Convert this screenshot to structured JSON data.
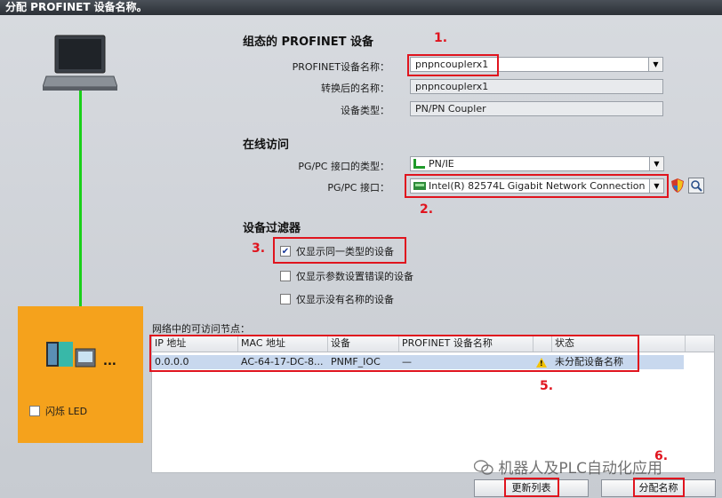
{
  "window": {
    "title": "分配 PROFINET 设备名称。"
  },
  "config": {
    "section_title": "组态的 PROFINET 设备",
    "device_name_label": "PROFINET设备名称：",
    "device_name_value": "pnpncouplerx1",
    "converted_name_label": "转换后的名称：",
    "converted_name_value": "pnpncouplerx1",
    "device_type_label": "设备类型：",
    "device_type_value": "PN/PN Coupler"
  },
  "online": {
    "section_title": "在线访问",
    "iface_type_label": "PG/PC 接口的类型：",
    "iface_type_value": "PN/IE",
    "iface_label": "PG/PC 接口：",
    "iface_value": "Intel(R) 82574L Gigabit Network Connection"
  },
  "filter": {
    "section_title": "设备过滤器",
    "opt_same_type": "仅显示同一类型的设备",
    "opt_same_type_checked": true,
    "opt_wrong_params": "仅显示参数设置错误的设备",
    "opt_no_name": "仅显示没有名称的设备"
  },
  "nodes": {
    "caption": "网络中的可访问节点：",
    "columns": [
      "IP 地址",
      "MAC 地址",
      "设备",
      "PROFINET 设备名称",
      "状态"
    ],
    "rows": [
      {
        "ip": "0.0.0.0",
        "mac": "AC-64-17-DC-8...",
        "device": "PNMF_IOC",
        "pn_name": "—",
        "status": "未分配设备名称"
      }
    ]
  },
  "topology": {
    "flash_led_label": "闪烁 LED",
    "device_more": "..."
  },
  "buttons": {
    "update_list": "更新列表",
    "assign_name": "分配名称"
  },
  "annotations": {
    "n1": "1.",
    "n2": "2.",
    "n3": "3.",
    "n5": "5.",
    "n6": "6."
  },
  "watermark": "机器人及PLC自动化应用",
  "colors": {
    "accent_red": "#e0141e",
    "link_green": "#19d019",
    "panel_orange": "#f5a21c",
    "row_select": "#c8d8ee"
  },
  "icons": [
    "laptop-icon",
    "device-icon",
    "network-icon",
    "nic-icon",
    "shield-icon",
    "search-icon",
    "warning-icon",
    "wechat-icon"
  ]
}
